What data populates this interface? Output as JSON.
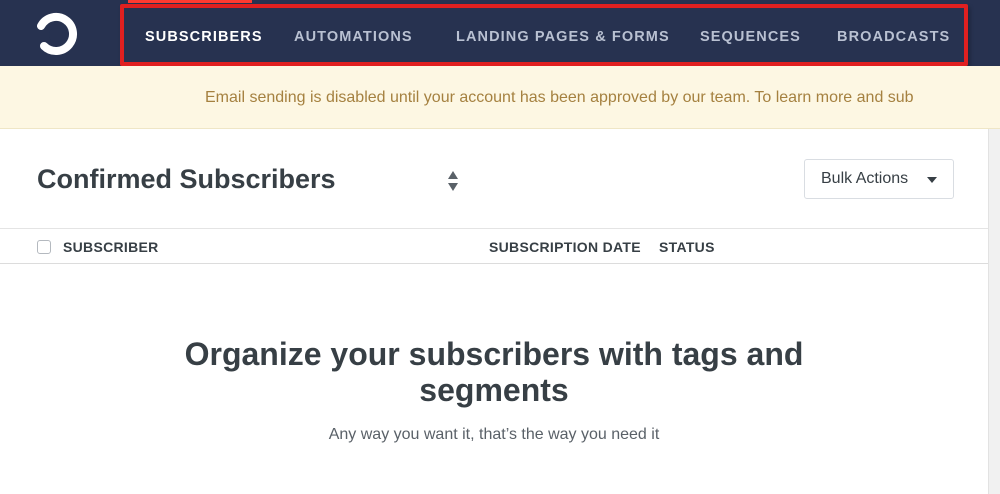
{
  "nav": {
    "items": [
      {
        "label": "SUBSCRIBERS",
        "active": true
      },
      {
        "label": "AUTOMATIONS",
        "active": false
      },
      {
        "label": "LANDING PAGES & FORMS",
        "active": false
      },
      {
        "label": "SEQUENCES",
        "active": false
      },
      {
        "label": "BROADCASTS",
        "active": false
      }
    ]
  },
  "banner": {
    "text": "Email sending is disabled until your account has been approved by our team. To learn more and sub"
  },
  "list": {
    "title": "Confirmed Subscribers",
    "bulk_actions_label": "Bulk Actions"
  },
  "table": {
    "columns": [
      "SUBSCRIBER",
      "SUBSCRIPTION DATE",
      "STATUS"
    ]
  },
  "empty_state": {
    "title": "Organize your subscribers with tags and segments",
    "subtitle": "Any way you want it, that’s the way you need it"
  },
  "icons": {
    "logo": "convertkit-logo-icon",
    "sort": "sort-arrows-icon",
    "caret": "caret-down-icon"
  },
  "colors": {
    "nav_bg": "#273250",
    "active_indicator": "#ff3a30",
    "highlight_box": "#e02020",
    "banner_bg": "#fdf7e3",
    "banner_text": "#a58140"
  }
}
